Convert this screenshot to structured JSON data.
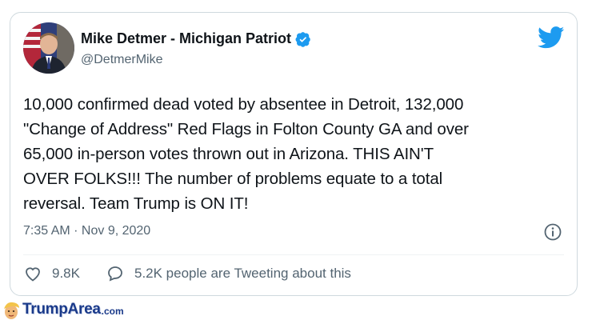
{
  "tweet": {
    "author_name": "Mike Detmer - Michigan Patriot",
    "handle": "@DetmerMike",
    "text": "10,000 confirmed dead voted by absentee in Detroit, 132,000\n\"Change of Address\" Red Flags in Folton County GA and over\n65,000 in-person votes thrown out in Arizona.  THIS AIN'T\nOVER FOLKS!!!  The number of problems equate to a total\nreversal.  Team Trump is ON IT!",
    "timestamp": "7:35 AM · Nov 9, 2020",
    "likes": "9.8K",
    "replies_label": "5.2K people are Tweeting about this",
    "verified": true
  },
  "watermark": {
    "brand": "TrumpArea",
    "suffix": ".com"
  },
  "colors": {
    "twitter_blue": "#1d9bf0",
    "text": "#0f1419",
    "muted": "#536471",
    "border": "#cfd9de"
  },
  "icons": [
    "twitter-bird-icon",
    "verified-badge-icon",
    "info-icon",
    "heart-icon",
    "speech-bubble-icon"
  ]
}
